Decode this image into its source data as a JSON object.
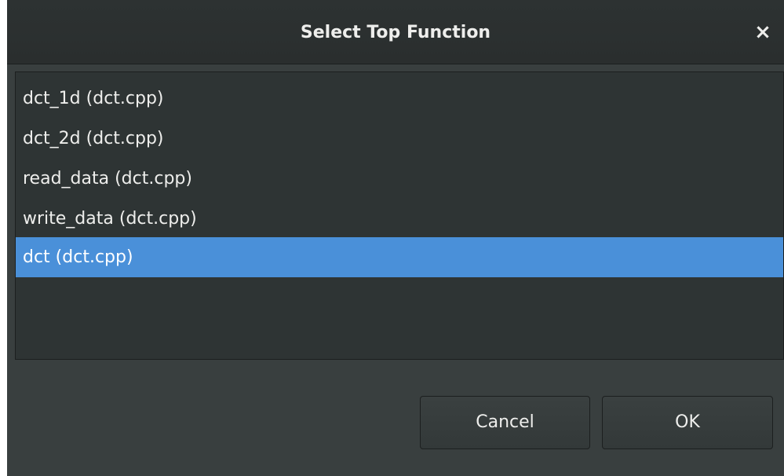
{
  "dialog": {
    "title": "Select Top Function",
    "close_icon": "×"
  },
  "list": {
    "items": [
      {
        "label": "dct_1d (dct.cpp)",
        "selected": false
      },
      {
        "label": "dct_2d (dct.cpp)",
        "selected": false
      },
      {
        "label": "read_data (dct.cpp)",
        "selected": false
      },
      {
        "label": "write_data (dct.cpp)",
        "selected": false
      },
      {
        "label": "dct (dct.cpp)",
        "selected": true
      }
    ]
  },
  "buttons": {
    "cancel_label": "Cancel",
    "ok_label": "OK"
  },
  "colors": {
    "background": "#393f3f",
    "titlebar": "#2d3232",
    "list_background": "#2e3434",
    "selection": "#4a90d9",
    "text": "#eeeeec"
  }
}
